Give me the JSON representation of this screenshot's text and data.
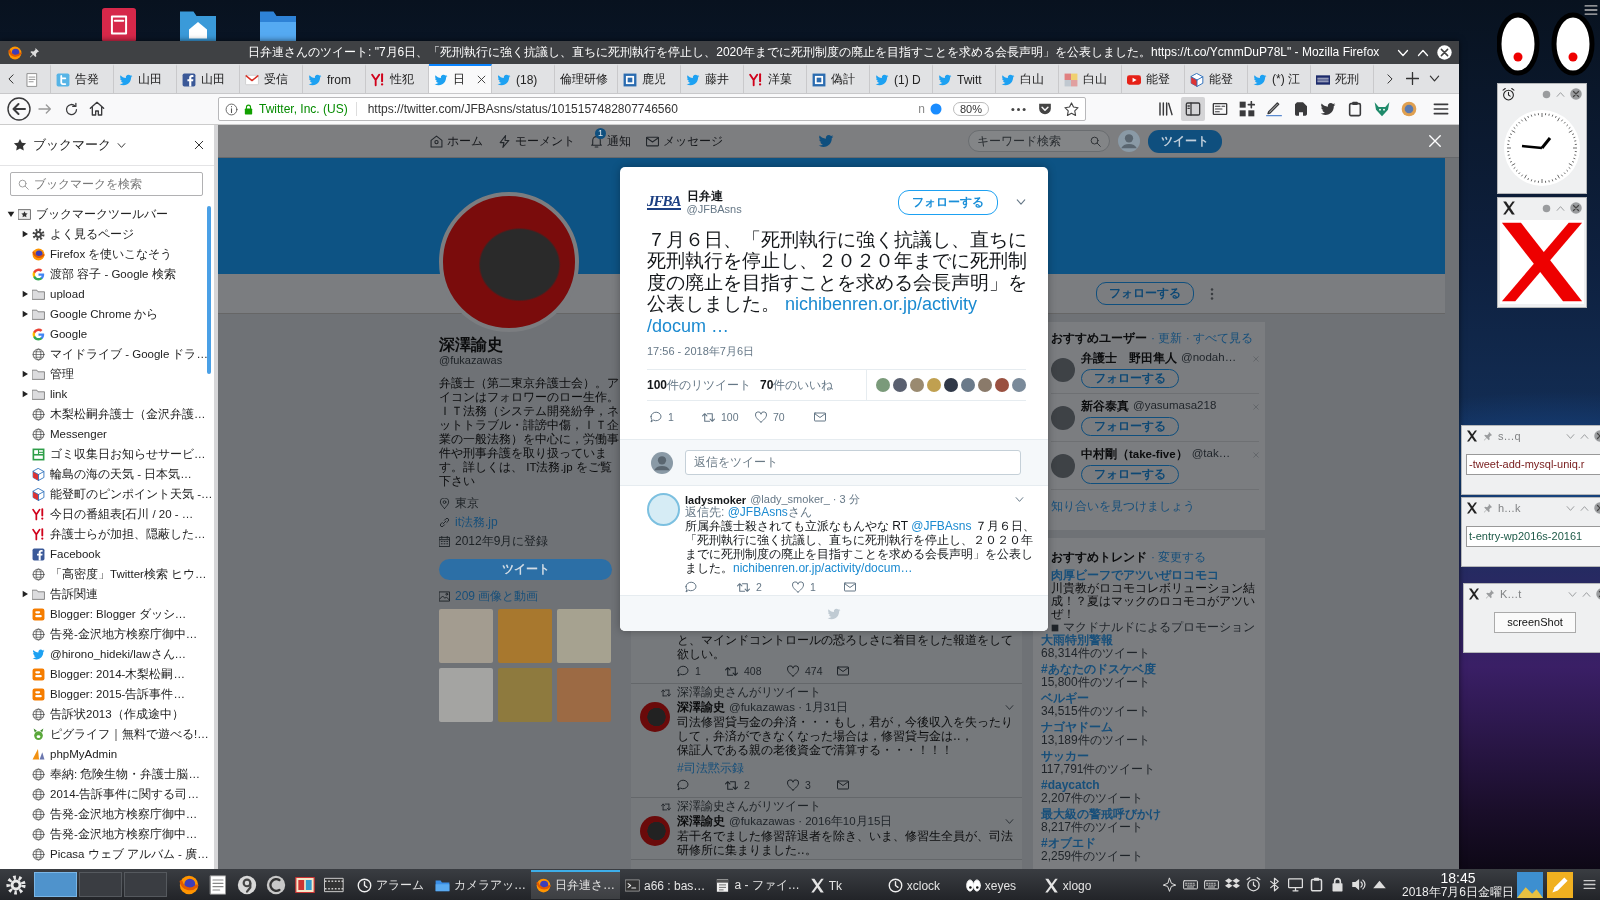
{
  "browser": {
    "title": "日弁連さんのツイート: \"7月6日、「死刑執行に強く抗議し、直ちに死刑執行を停止し、2020年までに死刑制度の廃止を目指すことを求める会長声明」を公表しました。https://t.co/YcmmDuP78L\" - Mozilla Firefox",
    "tabs": [
      {
        "kind": "generic",
        "selected": false
      },
      {
        "label": "告発",
        "kind": "tsq",
        "selected": false
      },
      {
        "label": "山田",
        "kind": "bird",
        "selected": false
      },
      {
        "label": "山田",
        "kind": "facebook",
        "selected": false
      },
      {
        "label": "受信",
        "kind": "gmail",
        "selected": false
      },
      {
        "label": "from",
        "kind": "bird",
        "selected": false
      },
      {
        "label": "性犯",
        "kind": "yahoo",
        "selected": false
      },
      {
        "label": "日",
        "kind": "bird",
        "selected": true
      },
      {
        "label": "(18)",
        "kind": "bird",
        "selected": false
      },
      {
        "label": "倫理研修",
        "kind": "none",
        "selected": false
      },
      {
        "label": "鹿児",
        "kind": "page",
        "selected": false
      },
      {
        "label": "藤井",
        "kind": "bird",
        "selected": false
      },
      {
        "label": "洋菓",
        "kind": "yahoo",
        "selected": false
      },
      {
        "label": "偽計",
        "kind": "page",
        "selected": false
      },
      {
        "label": "(1) D",
        "kind": "bird",
        "selected": false
      },
      {
        "label": "Twitt",
        "kind": "bird",
        "selected": false
      },
      {
        "label": "白山",
        "kind": "bird",
        "selected": false
      },
      {
        "label": "白山",
        "kind": "mosaic",
        "selected": false
      },
      {
        "label": "能登",
        "kind": "youtube",
        "selected": false
      },
      {
        "label": "能登",
        "kind": "cube",
        "selected": false
      },
      {
        "label": "(*) 江",
        "kind": "bird",
        "selected": false
      },
      {
        "label": "死刑",
        "kind": "nhk",
        "selected": false
      }
    ],
    "url_bar": {
      "identity": "Twitter, Inc. (US)",
      "url": "https://twitter.com/JFBAsns/status/1015157482807746560",
      "extension_label": "n",
      "zoom": "80%"
    },
    "toolbar": [
      {
        "kind": "library",
        "selected": false
      },
      {
        "kind": "sidebar",
        "selected": true
      },
      {
        "kind": "screenshot",
        "selected": false
      },
      {
        "kind": "grid",
        "selected": false
      },
      {
        "kind": "pen",
        "selected": false
      },
      {
        "kind": "elephant",
        "selected": false
      },
      {
        "kind": "tbird",
        "selected": false
      },
      {
        "kind": "clipboard",
        "selected": false
      },
      {
        "kind": "fox",
        "selected": false
      },
      {
        "kind": "avatar",
        "selected": false
      }
    ]
  },
  "sidebar": {
    "title": "ブックマーク",
    "search": {
      "placeholder": "ブックマークを検索"
    },
    "tree": [
      {
        "label": "ブックマークツールバー",
        "kind": "starfolder",
        "expanded": true,
        "children": [
          {
            "label": "よく見るページ",
            "kind": "gear",
            "expanded": false
          },
          {
            "label": "Firefox を使いこなそう",
            "kind": "firefox"
          },
          {
            "label": "渡部 容子 - Google 検索",
            "kind": "google"
          },
          {
            "label": "upload",
            "kind": "folder",
            "expanded": false
          },
          {
            "label": "Google Chrome から",
            "kind": "folder",
            "expanded": false
          },
          {
            "label": "Google",
            "kind": "google"
          },
          {
            "label": "マイドライブ - Google ドラ…",
            "kind": "globe"
          },
          {
            "label": "管理",
            "kind": "folder",
            "expanded": false
          },
          {
            "label": "link",
            "kind": "folder",
            "expanded": false
          },
          {
            "label": "木梨松嗣弁護士（金沢弁護…",
            "kind": "globe"
          },
          {
            "label": "Messenger",
            "kind": "globe"
          },
          {
            "label": "ゴミ収集日お知らせサービ…",
            "kind": "board"
          },
          {
            "label": "輪島の海の天気 - 日本気…",
            "kind": "cube"
          },
          {
            "label": "能登町のピンポイント天気 -…",
            "kind": "cube"
          },
          {
            "label": "今日の番組表[石川 / 20 - …",
            "kind": "yahoo"
          },
          {
            "label": "弁護士らが加担、隠蔽した…",
            "kind": "yahoo"
          },
          {
            "label": "Facebook",
            "kind": "facebook"
          },
          {
            "label": "「高密度」Twitter検索 ヒウ…",
            "kind": "globe"
          },
          {
            "label": "告訴関連",
            "kind": "folder",
            "expanded": false
          },
          {
            "label": "Blogger: Blogger ダッシ…",
            "kind": "blogger"
          },
          {
            "label": "告発-金沢地方検察庁御中…",
            "kind": "globe"
          },
          {
            "label": "@hirono_hideki/lawさん…",
            "kind": "bird"
          },
          {
            "label": "Blogger: 2014-木梨松嗣…",
            "kind": "blogger"
          },
          {
            "label": "Blogger: 2015-告訴事件…",
            "kind": "blogger"
          },
          {
            "label": "告訴状2013（作成途中）",
            "kind": "globe"
          },
          {
            "label": "ピグライフ｜無料で遊べる!…",
            "kind": "pig"
          },
          {
            "label": "phpMyAdmin",
            "kind": "pma"
          },
          {
            "label": "奉納: 危険生物・弁護士脳…",
            "kind": "globe"
          },
          {
            "label": "2014-告訴事件に関する司…",
            "kind": "globe"
          },
          {
            "label": "告発-金沢地方検察庁御中…",
            "kind": "globe"
          },
          {
            "label": "告発-金沢地方検察庁御中…",
            "kind": "globe"
          },
          {
            "label": "Picasa ウェブ アルバム - 廣…",
            "kind": "globe"
          }
        ]
      }
    ]
  },
  "page": {
    "nav": [
      {
        "label": "ホーム",
        "kind": "thome"
      },
      {
        "label": "モーメント",
        "kind": "bolt"
      },
      {
        "label": "通知",
        "kind": "bell",
        "badge": "1"
      },
      {
        "label": "メッセージ",
        "kind": "mail"
      }
    ],
    "search": {
      "placeholder": "キーワード検索"
    },
    "tweet_button": "ツイート",
    "follow_button": "フォローする",
    "profile": {
      "name": "深澤諭史",
      "handle": "@fukazawas",
      "bio": "弁護士（第二東京弁護士会）。アイコンはフォロワーのロー生作。ＩＴ法務（システム開発紛争，ネットトラブル・誹謗中傷，ＩＴ企業の一般法務）を中心に，労働事件や刑事弁護を取り扱っています。詳しくは、 IT法務.jp をご覧下さい",
      "location": "東京",
      "website": "it法務.jp",
      "joined": "2012年9月に登録",
      "tweet_button": "ツイート",
      "media": "209 画像と動画"
    },
    "timeline": [
      {
        "kind": "tail",
        "paragraphs": [
          "と、マインドコントロールの恐ろしさに着目をした報道をして欲しい。"
        ],
        "replies": "1",
        "retweets": "408",
        "likes": "474"
      },
      {
        "kind": "retweet",
        "context": "深澤諭史さんがリツイート",
        "name": "深澤諭史",
        "meta": "@fukazawas · 1月31日",
        "paragraphs": [
          "司法修習貸与金の弁済・・・もし，君が，今後収入を失ったりして，弁済ができなくなった場合は，修習貸与金は‥，",
          "保証人である親の老後資金で清算する・・・！！！"
        ],
        "hashtag": "#司法黙示録",
        "retweets": "2",
        "likes": "3"
      },
      {
        "kind": "retweet",
        "context": "深澤諭史さんがリツイート",
        "name": "深澤諭史",
        "meta": "@fukazawas · 2016年10月15日",
        "paragraphs": [
          "若干名でました修習辞退者を除き、いま、修習生全員が、司法研修所に集まりました‥。"
        ]
      }
    ],
    "who_to_follow": {
      "title": "おすすめユーザー",
      "links": "· 更新 · すべて見る",
      "users": [
        {
          "name": "弁護士　野田隼人",
          "handle": "@nodah…",
          "follow": "フォローする"
        },
        {
          "name": "新谷泰真",
          "handle": "@yasumasa218",
          "follow": "フォローする"
        },
        {
          "name": "中村剛（take-five）",
          "handle": "@tak…",
          "follow": "フォローする"
        }
      ],
      "find_friends": "知り合いを見つけましょう"
    },
    "trends": {
      "title": "おすすめトレンド",
      "links": "· 変更する",
      "promoted": {
        "name": "肉厚ビーフでアツいぜロコモコ",
        "lines": [
          "川貴教がロコモコレボリューション結",
          "成！？夏はマックのロコモコがアツい",
          "ぜ！"
        ],
        "label": "マクドナルドによるプロモーション"
      },
      "items": [
        {
          "name": "大雨特別警報",
          "count": "68,314件のツイート"
        },
        {
          "name": "#あなたのドスケベ度",
          "count": "15,800件のツイート"
        },
        {
          "name": "ベルギー",
          "count": "34,515件のツイート"
        },
        {
          "name": "ナゴヤドーム",
          "count": "13,189件のツイート"
        },
        {
          "name": "サッカー",
          "count": "117,791件のツイート"
        },
        {
          "name": "#daycatch",
          "count": "2,207件のツイート"
        },
        {
          "name": "最大級の警戒呼びかけ",
          "count": "8,217件のツイート"
        },
        {
          "name": "#オブエド",
          "count": "2,259件のツイート"
        }
      ]
    }
  },
  "modal": {
    "logo": "JFBA",
    "name": "日弁連",
    "handle": "@JFBAsns",
    "follow": "フォローする",
    "text": "７月６日、「死刑執行に強く抗議し、直ちに死刑執行を停止し、２０２０年までに死刑制度の廃止を目指すことを求める会長声明」を公表しました。",
    "link_parts": [
      "nichibenren.or.jp/activity",
      "/docum …"
    ],
    "timestamp": "17:56 - 2018年7月6日",
    "retweet_stat": "**100**件のリツイート",
    "like_stat": "**70**件のいいね",
    "replies": "1",
    "retweets": "100",
    "likes": "70",
    "reply_placeholder": "返信をツイート",
    "reply": {
      "name": "ladysmoker",
      "meta": "@lady_smoker_ · 3 分",
      "reply_to": [
        {
          "kind": "text",
          "text": "返信先: "
        },
        {
          "kind": "link",
          "text": "@JFBAsns"
        },
        {
          "kind": "text",
          "text": "さん"
        }
      ],
      "text": [
        {
          "kind": "text",
          "text": "所属弁護士殺されても立派なもんやな RT "
        },
        {
          "kind": "link",
          "text": "@JFBAsns"
        },
        {
          "kind": "text",
          "text": " ７月６日、「死刑執行に強く抗議し、直ちに死刑執行を停止し、２０２０年までに死刑制度の廃止を目指すことを求める会長声明」を公表しました。"
        },
        {
          "kind": "link",
          "text": "nichibenren.or.jp/activity/docum…"
        }
      ],
      "retweets": "2",
      "likes": "1"
    }
  },
  "widgets": {
    "windows": [
      {
        "title": "s…q",
        "kind": "field",
        "value": "-tweet-add-mysql-uniq.r",
        "color": "#7a2020"
      },
      {
        "title": "h…k",
        "kind": "field",
        "value": "t-entry-wp2016s-20161",
        "color": "#1e5a48"
      },
      {
        "title": "K…t",
        "kind": "button",
        "label": "screenShot"
      }
    ]
  },
  "taskbar": {
    "pager": [
      {
        "selected": true
      },
      {
        "selected": false
      },
      {
        "selected": false
      }
    ],
    "tasks": [
      {
        "label": "アラーム",
        "kind": "clockapp",
        "selected": false
      },
      {
        "label": "カメラアッ…",
        "kind": "folderblue",
        "selected": false
      },
      {
        "label": "日弁連さ…",
        "kind": "firefox",
        "selected": true
      },
      {
        "label": "a66 : bas…",
        "kind": "term",
        "selected": false
      },
      {
        "label": "a - ファイ…",
        "kind": "editor",
        "selected": false
      },
      {
        "label": "Tk",
        "kind": "xapp",
        "selected": false
      },
      {
        "label": "xclock",
        "kind": "clockapp",
        "selected": false
      },
      {
        "label": "xeyes",
        "kind": "eyes",
        "selected": false
      },
      {
        "label": "xlogo",
        "kind": "xapp",
        "selected": false
      }
    ],
    "time": "18:45",
    "date": "2018年7月6日金曜日"
  }
}
